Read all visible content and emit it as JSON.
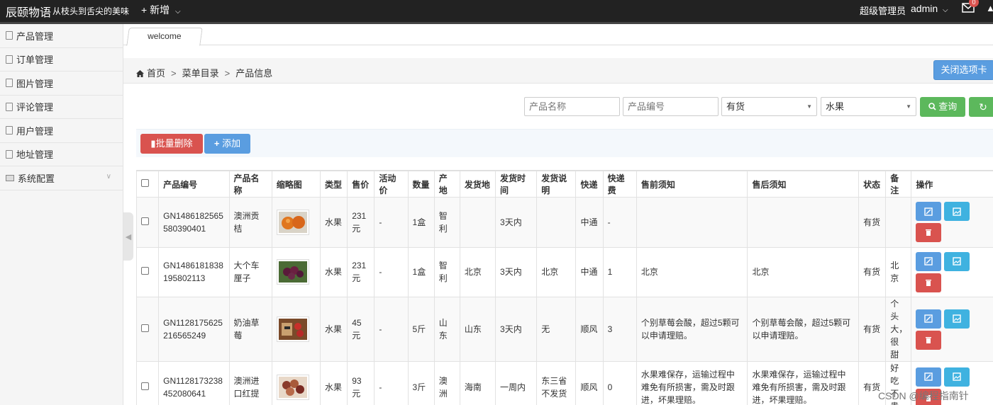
{
  "header": {
    "brand": "辰颐物语",
    "brand_sub": "从枝头到舌尖的美味",
    "new_label": "新增",
    "role": "超级管理员",
    "user": "admin",
    "mail_count": "0"
  },
  "sidebar": {
    "items": [
      {
        "label": "产品管理"
      },
      {
        "label": "订单管理"
      },
      {
        "label": "图片管理"
      },
      {
        "label": "评论管理"
      },
      {
        "label": "用户管理"
      },
      {
        "label": "地址管理"
      },
      {
        "label": "系统配置"
      }
    ]
  },
  "tabs": [
    {
      "label": "welcome"
    }
  ],
  "breadcrumb": {
    "home": "首页",
    "menu": "菜单目录",
    "current": "产品信息",
    "sep": ">"
  },
  "close_tabs_label": "关闭选项卡",
  "search": {
    "name_placeholder": "产品名称",
    "code_placeholder": "产品编号",
    "stock_value": "有货",
    "type_value": "水果",
    "query_label": "查询"
  },
  "actions": {
    "batch_delete": "批量删除",
    "add": "添加"
  },
  "table": {
    "headers": [
      "产品编号",
      "产品名称",
      "缩略图",
      "类型",
      "售价",
      "活动价",
      "数量",
      "产地",
      "发货地",
      "发货时间",
      "发货说明",
      "快递",
      "快递费",
      "售前须知",
      "售后须知",
      "状态",
      "备注",
      "操作"
    ],
    "rows": [
      {
        "code": "GN1486182565580390401",
        "name": "澳洲贡桔",
        "type": "水果",
        "price": "231元",
        "promo": "-",
        "qty": "1盒",
        "origin": "智利",
        "ship_from": "",
        "ship_time": "3天内",
        "ship_note": "",
        "courier": "中通",
        "fee": "-",
        "pre": "",
        "post": "",
        "status": "有货",
        "remark": ""
      },
      {
        "code": "GN1486181838195802113",
        "name": "大个车厘子",
        "type": "水果",
        "price": "231元",
        "promo": "-",
        "qty": "1盒",
        "origin": "智利",
        "ship_from": "北京",
        "ship_time": "3天内",
        "ship_note": "北京",
        "courier": "中通",
        "fee": "1",
        "pre": "北京",
        "post": "北京",
        "status": "有货",
        "remark": "北京"
      },
      {
        "code": "GN1128175625216565249",
        "name": "奶油草莓",
        "type": "水果",
        "price": "45元",
        "promo": "-",
        "qty": "5斤",
        "origin": "山东",
        "ship_from": "山东",
        "ship_time": "3天内",
        "ship_note": "无",
        "courier": "顺风",
        "fee": "3",
        "pre": "个别草莓会酸，超过5颗可以申请理赔。",
        "post": "个别草莓会酸，超过5颗可以申请理赔。",
        "status": "有货",
        "remark": "个头大，很甜"
      },
      {
        "code": "GN1128173238452080641",
        "name": "澳洲进口红提",
        "type": "水果",
        "price": "93元",
        "promo": "-",
        "qty": "3斤",
        "origin": "澳洲",
        "ship_from": "海南",
        "ship_time": "一周内",
        "ship_note": "东三省不发货",
        "courier": "顺风",
        "fee": "0",
        "pre": "水果难保存，运输过程中难免有所损害，需及时跟进，坏果理赔。",
        "post": "水果难保存，运输过程中难免有所损害，需及时跟进，坏果理赔。",
        "status": "有货",
        "remark": "好吃不贵"
      }
    ]
  },
  "watermark": "CSDN @编程指南针",
  "colors": {
    "topbar": "#222222",
    "primary": "#5a9de0",
    "success": "#5cb85c",
    "danger": "#d9534f",
    "info": "#3fb2e0"
  }
}
